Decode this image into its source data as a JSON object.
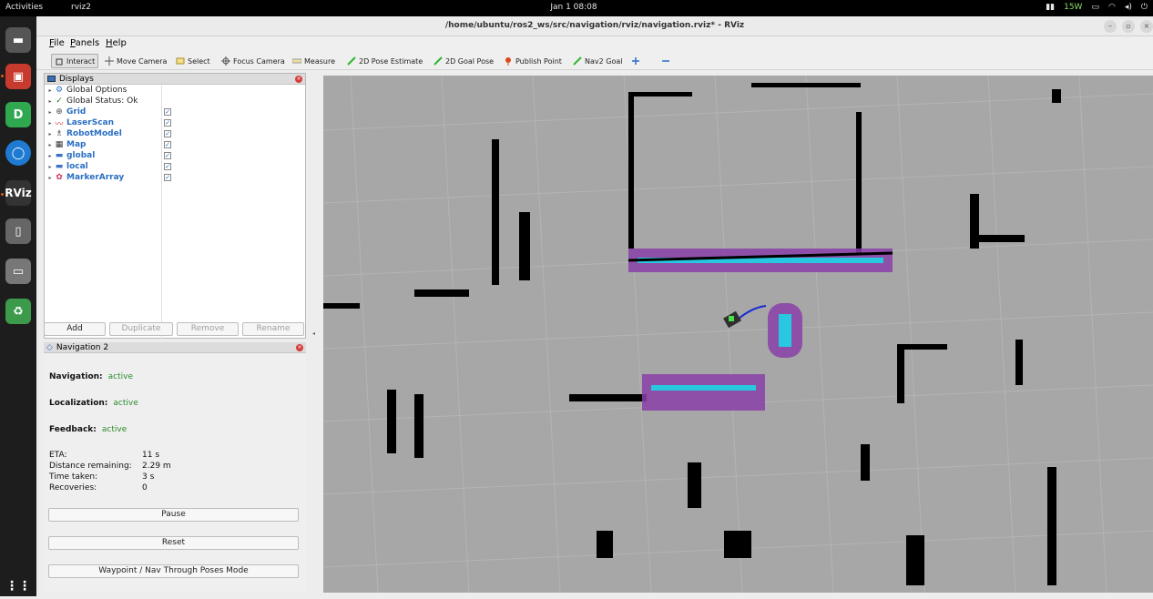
{
  "topbar": {
    "activities": "Activities",
    "app_name": "rviz2",
    "clock": "Jan 1  08:08",
    "power": "15W"
  },
  "window": {
    "title": "/home/ubuntu/ros2_ws/src/navigation/rviz/navigation.rviz* - RViz"
  },
  "menu": [
    "File",
    "Panels",
    "Help"
  ],
  "toolbar": {
    "interact": "Interact",
    "move_camera": "Move Camera",
    "select": "Select",
    "focus_camera": "Focus Camera",
    "measure": "Measure",
    "pose_estimate": "2D Pose Estimate",
    "goal_pose": "2D Goal Pose",
    "publish_point": "Publish Point",
    "nav2_goal": "Nav2 Goal"
  },
  "displays": {
    "title": "Displays",
    "items": [
      {
        "label": "Global Options",
        "checked": false
      },
      {
        "label": "Global Status: Ok",
        "checked": false
      },
      {
        "label": "Grid",
        "checked": true
      },
      {
        "label": "LaserScan",
        "checked": true
      },
      {
        "label": "RobotModel",
        "checked": true
      },
      {
        "label": "Map",
        "checked": true
      },
      {
        "label": "global",
        "checked": true
      },
      {
        "label": "local",
        "checked": true
      },
      {
        "label": "MarkerArray",
        "checked": true
      }
    ],
    "buttons": {
      "add": "Add",
      "duplicate": "Duplicate",
      "remove": "Remove",
      "rename": "Rename"
    }
  },
  "nav2": {
    "title": "Navigation 2",
    "navigation_label": "Navigation:",
    "navigation_value": "active",
    "localization_label": "Localization:",
    "localization_value": "active",
    "feedback_label": "Feedback:",
    "feedback_value": "active",
    "eta_label": "ETA:",
    "eta_value": "11 s",
    "distance_label": "Distance remaining:",
    "distance_value": "2.29 m",
    "time_label": "Time taken:",
    "time_value": "3 s",
    "recoveries_label": "Recoveries:",
    "recoveries_value": "0",
    "pause": "Pause",
    "reset": "Reset",
    "mode": "Waypoint / Nav Through Poses Mode"
  },
  "colors": {
    "viewport_bg": "#a7a7a7",
    "costmap": "#8a3fa8",
    "inflation_cyan": "#28c8e0",
    "status_green": "#2b8a2b",
    "link_blue": "#2a6fc3"
  }
}
